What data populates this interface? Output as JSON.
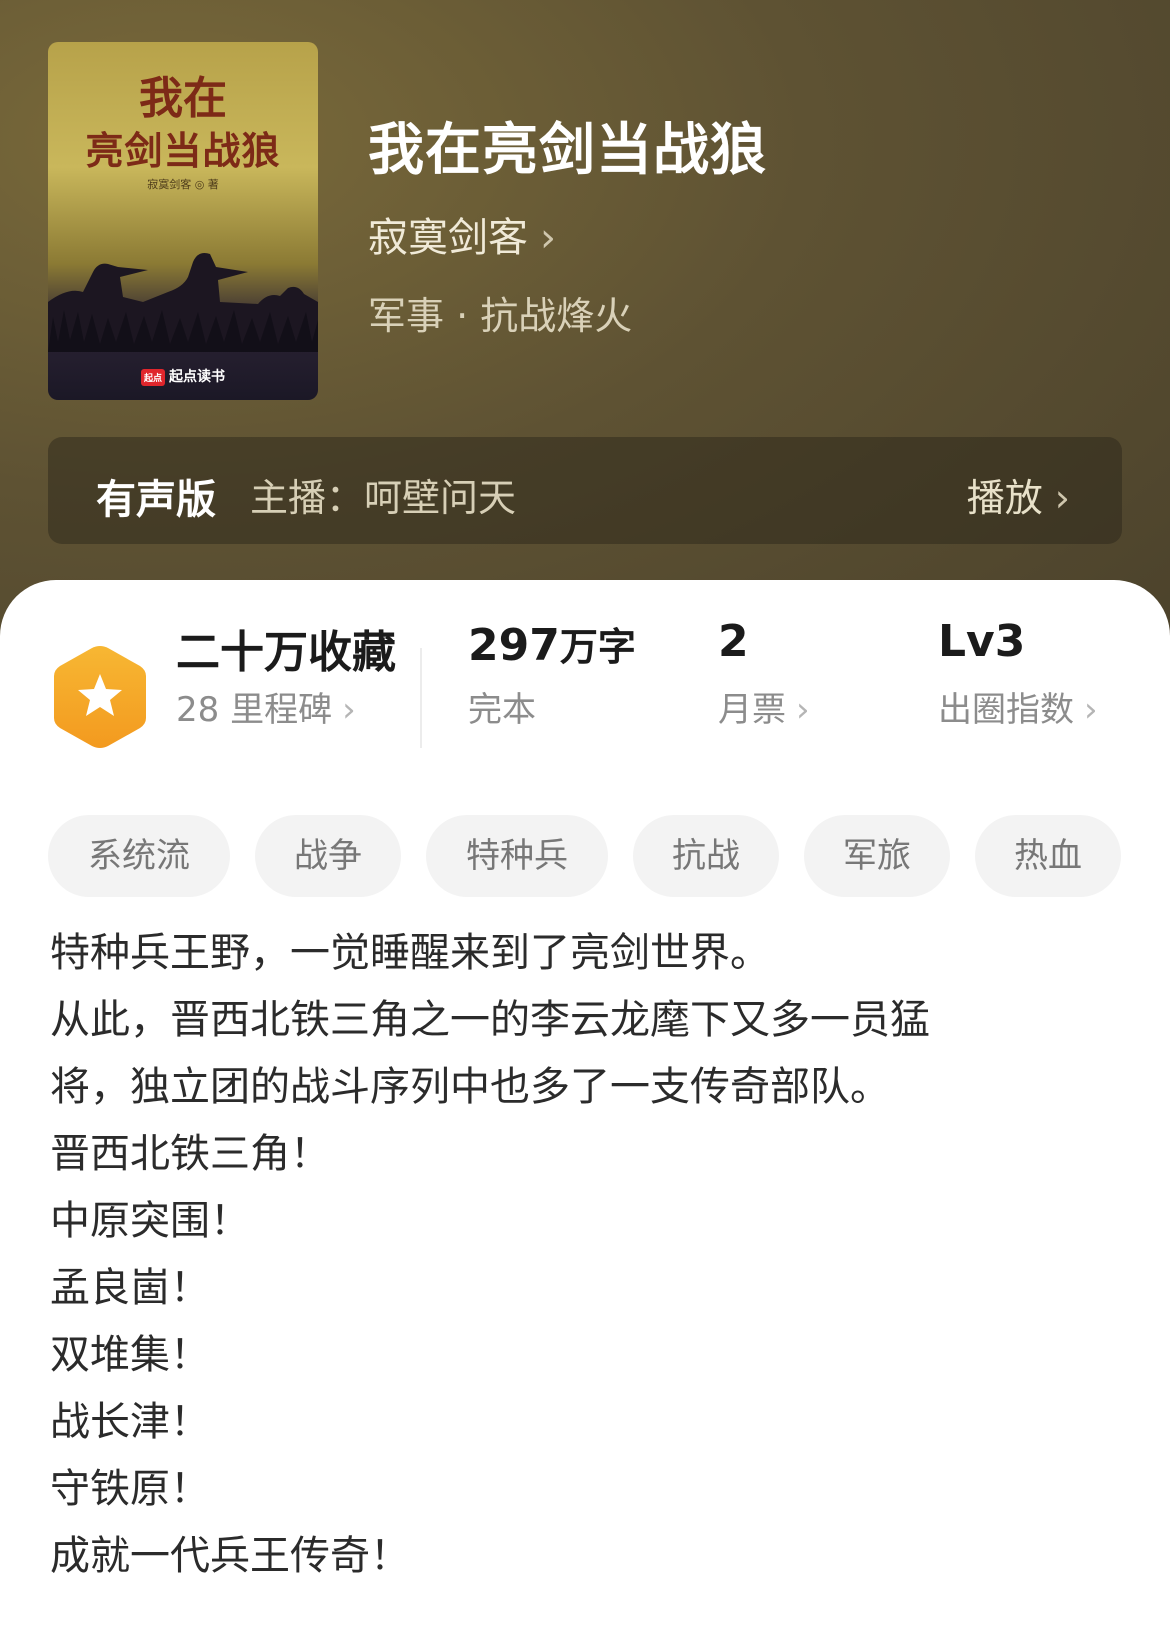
{
  "book": {
    "title": "我在亮剑当战狼",
    "author": "寂寞剑客",
    "category": "军事 · 抗战烽火",
    "cover": {
      "title_line1": "我在",
      "title_line2": "亮剑当战狼",
      "author_line": "寂寞剑客 ◎ 著",
      "publisher": "起点读书",
      "publisher_mark": "起点"
    }
  },
  "audio": {
    "label": "有声版",
    "host": "主播：呵壁问天",
    "play_label": "播放"
  },
  "stats": {
    "collect": {
      "main": "二十万收藏",
      "sub": "28 里程碑"
    },
    "words": {
      "value": "297",
      "unit": "万字",
      "sub": "完本"
    },
    "monthly": {
      "value": "2",
      "sub": "月票"
    },
    "influence": {
      "value": "Lv3",
      "sub": "出圈指数"
    }
  },
  "tags": [
    "系统流",
    "战争",
    "特种兵",
    "抗战",
    "军旅",
    "热血"
  ],
  "description": [
    "特种兵王野，一觉睡醒来到了亮剑世界。",
    "从此，晋西北铁三角之一的李云龙麾下又多一员猛",
    "将，独立团的战斗序列中也多了一支传奇部队。",
    "晋西北铁三角！",
    "中原突围！",
    "孟良崮！",
    "双堆集！",
    "战长津！",
    "守铁原！",
    "成就一代兵王传奇！"
  ],
  "colors": {
    "header_bg": "#5e5233",
    "badge": "#f5a623",
    "tag_bg": "#f3f3f3"
  },
  "icons": {
    "badge": "star-hexagon-icon",
    "chevron": "chevron-right-icon"
  }
}
